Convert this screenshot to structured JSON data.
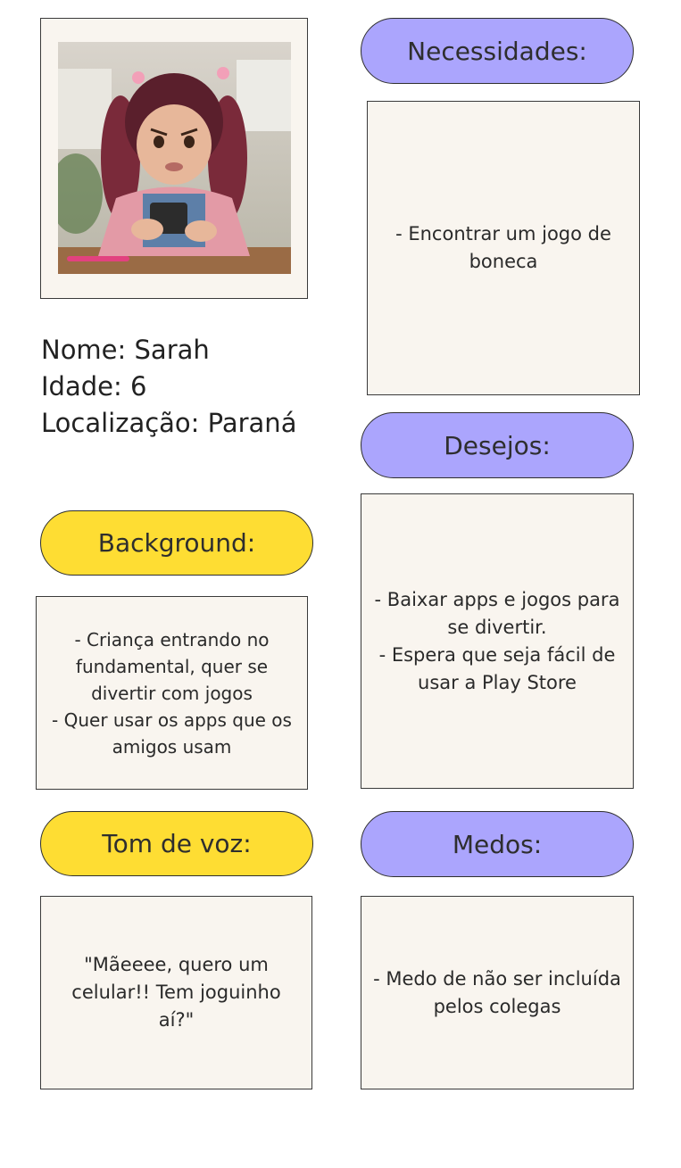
{
  "persona": {
    "name_line": "Nome: Sarah",
    "age_line": "Idade: 6",
    "location_line": "Localização: Paraná"
  },
  "background": {
    "label": "Background:",
    "lines": [
      "- Criança entrando no",
      "fundamental, quer se",
      "divertir com jogos",
      "- Quer usar os apps que os",
      "amigos usam"
    ]
  },
  "tone": {
    "label": "Tom de voz:",
    "lines": [
      "\"Mãeeee, quero um",
      "celular!! Tem joguinho aí?\""
    ]
  },
  "needs": {
    "label": "Necessidades:",
    "lines": [
      "- Encontrar um jogo de",
      "boneca"
    ]
  },
  "desires": {
    "label": "Desejos:",
    "lines": [
      "- Baixar apps e jogos para",
      "se divertir.",
      "- Espera que seja fácil de",
      "usar a Play Store"
    ]
  },
  "fears": {
    "label": "Medos:",
    "lines": [
      "- Medo de não ser incluída",
      "pelos colegas"
    ]
  },
  "colors": {
    "yellow_pill": "#fedd33",
    "purple_pill": "#aba5fd",
    "card_bg": "#f9f5ef"
  }
}
